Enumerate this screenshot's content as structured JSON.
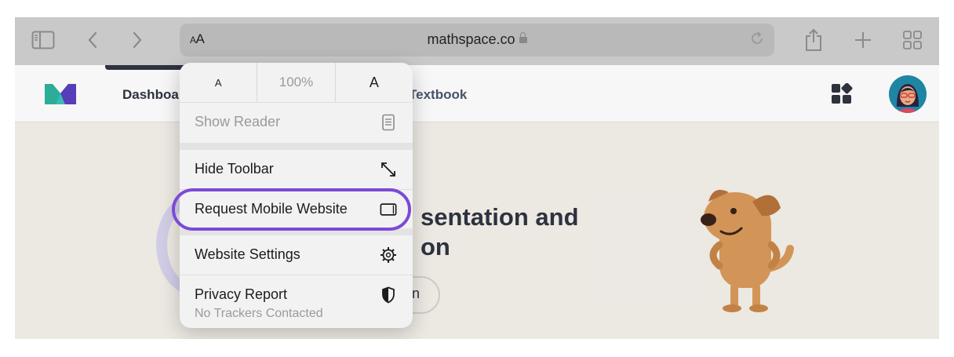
{
  "browser": {
    "reader_text_label_small": "A",
    "reader_text_label_large": "A",
    "domain": "mathspace.co",
    "icons": {
      "sidebar": "sidebar-icon",
      "back": "chevron-left-icon",
      "forward": "chevron-right-icon",
      "lock": "lock-icon",
      "reload": "reload-icon",
      "share": "share-icon",
      "new_tab": "plus-icon",
      "tabs": "tab-overview-icon"
    }
  },
  "site": {
    "nav_dashboard": "Dashboa",
    "nav_textbook": "Textbook",
    "hero_line1": "sentation and",
    "hero_line2": "on",
    "hero_button": "n",
    "colors": {
      "brand_teal": "#3cc2b8",
      "brand_purple": "#5a3fc0",
      "dog": "#d99a5a"
    }
  },
  "menu": {
    "zoom_decrease": "A",
    "zoom_level": "100%",
    "zoom_increase": "A",
    "show_reader": "Show Reader",
    "hide_toolbar": "Hide Toolbar",
    "request_mobile": "Request Mobile Website",
    "website_settings": "Website Settings",
    "privacy_report": "Privacy Report",
    "privacy_sub": "No Trackers Contacted",
    "highlight_color": "#7c4ad6"
  }
}
